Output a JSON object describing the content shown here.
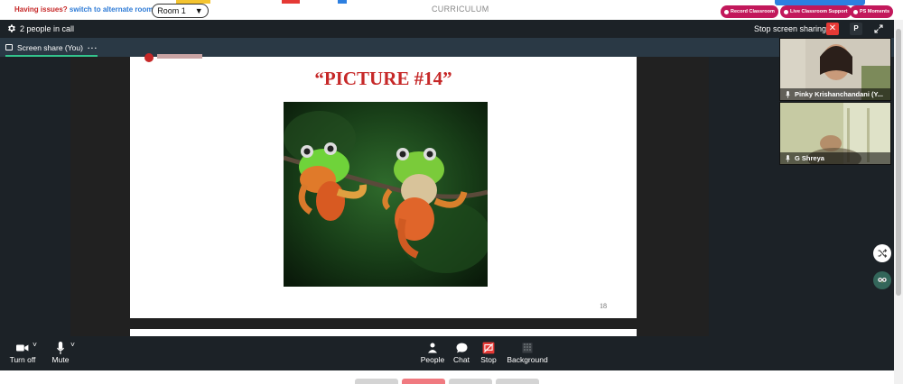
{
  "topbar": {
    "issue_question": "Having issues?",
    "issue_link": "switch to alternate room",
    "room_value": "Room 1",
    "section_title": "CURRICULUM",
    "pills": [
      "Record Classroom",
      "Live Classroom Support",
      "PS Moments"
    ],
    "colors": {
      "pill": "#c2185b",
      "issue": "#c62828",
      "link": "#2e7bd6"
    }
  },
  "call": {
    "people_count": "2 people in call",
    "stop_sharing": "Stop screen sharing",
    "avatar_initial": "P"
  },
  "tabs": {
    "screen_share": "Screen share (You)"
  },
  "slide": {
    "title": "“PICTURE #14”",
    "page_number": "18"
  },
  "participants": [
    {
      "name": "Pinky Krishanchandani (Y..."
    },
    {
      "name": "G Shreya"
    }
  ],
  "controls": {
    "camera": "Turn off",
    "mic": "Mute",
    "people": "People",
    "chat": "Chat",
    "stop": "Stop",
    "background": "Background"
  },
  "icons": {
    "settings": "gear-icon",
    "close": "close-icon",
    "expand": "expand-icon",
    "camera": "video-camera-icon",
    "mic": "microphone-icon",
    "people": "person-icon",
    "chat": "chat-bubble-icon",
    "stop": "stop-share-icon",
    "background": "background-icon"
  }
}
